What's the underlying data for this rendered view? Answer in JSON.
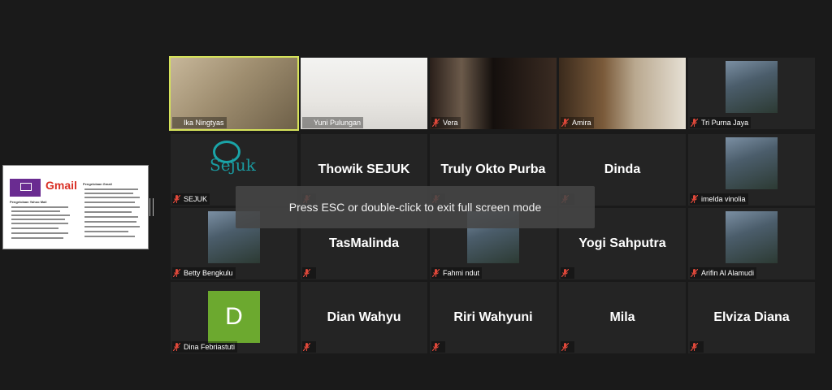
{
  "shared_screen": {
    "left_title": "Pengelolaan Yahoo Mail",
    "brand": "Gmail",
    "right_title": "Pengelolaan Gmail"
  },
  "toast": "Press ESC or double-click to exit full screen mode",
  "participants": [
    {
      "name": "Ika Ningtyas",
      "type": "video",
      "active": true,
      "mic": "on"
    },
    {
      "name": "Yuni Pulungan",
      "type": "video",
      "mic": "on"
    },
    {
      "name": "Vera",
      "type": "video",
      "mic": "muted"
    },
    {
      "name": "Amira",
      "type": "video",
      "mic": "muted"
    },
    {
      "name": "Tri Purna Jaya",
      "type": "photo",
      "mic": "muted"
    },
    {
      "name": "SEJUK",
      "type": "logo",
      "logo_text": "Sejuk",
      "mic": "muted"
    },
    {
      "name": "Thowik SEJUK",
      "type": "text",
      "mic": "muted"
    },
    {
      "name": "Truly Okto Purba",
      "type": "text",
      "mic": "muted"
    },
    {
      "name": "Dinda",
      "type": "text",
      "mic": "muted"
    },
    {
      "name": "imelda vinolia",
      "type": "photo",
      "mic": "muted"
    },
    {
      "name": "Betty Bengkulu",
      "type": "photo",
      "mic": "muted"
    },
    {
      "name": "TasMalinda",
      "type": "text",
      "mic": "muted"
    },
    {
      "name": "Fahmi ndut",
      "type": "photo",
      "mic": "muted"
    },
    {
      "name": "Yogi Sahputra",
      "type": "text",
      "mic": "muted"
    },
    {
      "name": "Arifin Al Alamudi",
      "type": "photo",
      "mic": "muted"
    },
    {
      "name": "Dina Febriastuti",
      "type": "initial",
      "initial": "D",
      "mic": "muted"
    },
    {
      "name": "Dian Wahyu",
      "type": "text",
      "mic": "muted"
    },
    {
      "name": "Riri Wahyuni",
      "type": "text",
      "mic": "muted"
    },
    {
      "name": "Mila",
      "type": "text",
      "mic": "muted"
    },
    {
      "name": "Elviza Diana",
      "type": "text",
      "mic": "muted"
    }
  ],
  "colors": {
    "active_border": "#d6e35a",
    "muted_mic": "#e0483a",
    "avatar_green": "#6ca92f",
    "sejuk_teal": "#1a9aa0"
  }
}
